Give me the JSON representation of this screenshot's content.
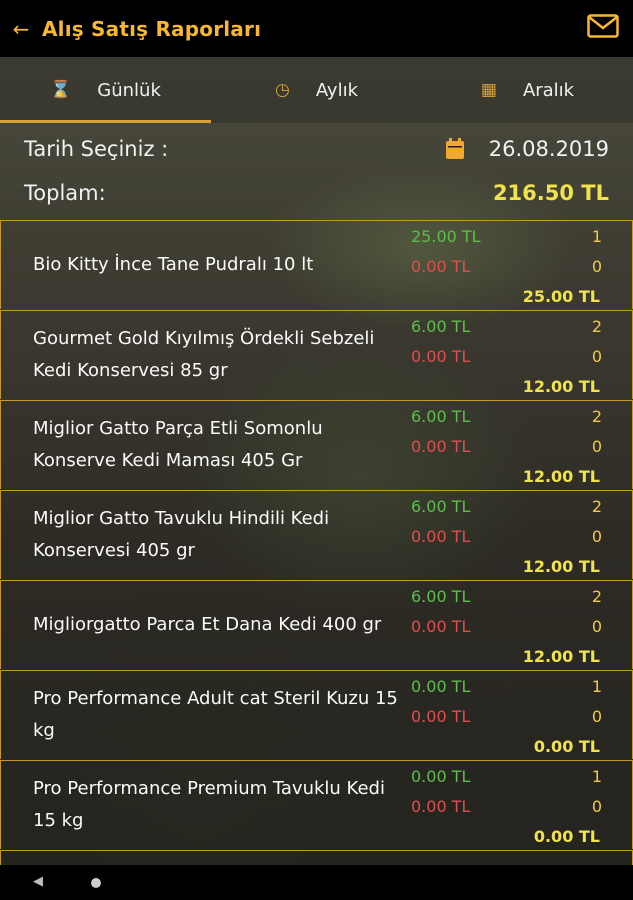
{
  "header": {
    "title": "Alış Satış Raporları",
    "back_icon": "arrow-left-icon",
    "mail_icon": "mail-icon"
  },
  "tabs": [
    {
      "label": "Günlük",
      "icon": "hourglass-icon",
      "active": true
    },
    {
      "label": "Aylık",
      "icon": "clock-icon",
      "active": false
    },
    {
      "label": "Aralık",
      "icon": "calendar-icon",
      "active": false
    }
  ],
  "summary": {
    "date_label": "Tarih Seçiniz :",
    "date_value": "26.08.2019",
    "total_label": "Toplam:",
    "total_value": "216.50 TL"
  },
  "items": [
    {
      "name": "Bio Kitty İnce Tane Pudralı 10 lt",
      "price_in": "25.00 TL",
      "price_out": "0.00 TL",
      "qty_in": "1",
      "qty_out": "0",
      "total": "25.00 TL"
    },
    {
      "name": "Gourmet Gold Kıyılmış Ördekli Sebzeli Kedi Konservesi 85 gr",
      "price_in": "6.00 TL",
      "price_out": "0.00 TL",
      "qty_in": "2",
      "qty_out": "0",
      "total": "12.00 TL"
    },
    {
      "name": "Miglior Gatto Parça Etli Somonlu Konserve Kedi Maması 405 Gr",
      "price_in": "6.00 TL",
      "price_out": "0.00 TL",
      "qty_in": "2",
      "qty_out": "0",
      "total": "12.00 TL"
    },
    {
      "name": "Miglior Gatto Tavuklu Hindili Kedi Konservesi 405 gr",
      "price_in": "6.00 TL",
      "price_out": "0.00 TL",
      "qty_in": "2",
      "qty_out": "0",
      "total": "12.00 TL"
    },
    {
      "name": "Migliorgatto Parca Et Dana Kedi 400 gr",
      "price_in": "6.00 TL",
      "price_out": "0.00 TL",
      "qty_in": "2",
      "qty_out": "0",
      "total": "12.00 TL"
    },
    {
      "name": "Pro Performance Adult cat Steril Kuzu 15 kg",
      "price_in": "0.00 TL",
      "price_out": "0.00 TL",
      "qty_in": "1",
      "qty_out": "0",
      "total": "0.00 TL"
    },
    {
      "name": "Pro Performance Premium Tavuklu Kedi 15 kg",
      "price_in": "0.00 TL",
      "price_out": "0.00 TL",
      "qty_in": "1",
      "qty_out": "0",
      "total": "0.00 TL"
    }
  ],
  "colors": {
    "accent": "#f7b731",
    "income": "#5bbf4a",
    "expense": "#e14d4d",
    "total": "#f1e34a"
  }
}
